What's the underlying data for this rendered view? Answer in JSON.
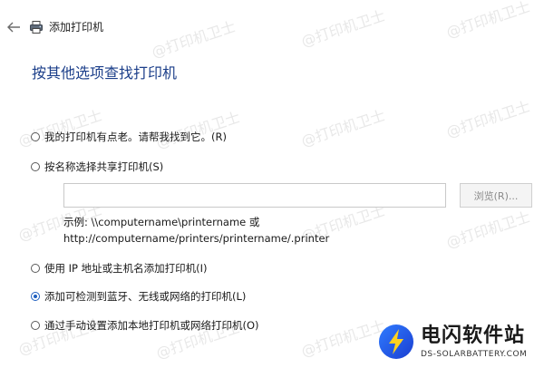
{
  "header": {
    "title": "添加打印机",
    "back_icon": "back-arrow-icon",
    "printer_icon": "printer-icon"
  },
  "heading": "按其他选项查找打印机",
  "options": [
    {
      "label": "我的打印机有点老。请帮我找到它。(R)",
      "checked": false
    },
    {
      "label": "按名称选择共享打印机(S)",
      "checked": false
    },
    {
      "label": "使用 IP 地址或主机名添加打印机(I)",
      "checked": false
    },
    {
      "label": "添加可检测到蓝牙、无线或网络的打印机(L)",
      "checked": true
    },
    {
      "label": "通过手动设置添加本地打印机或网络打印机(O)",
      "checked": false
    }
  ],
  "share_input": {
    "value": "",
    "placeholder": ""
  },
  "browse_label": "浏览(R)...",
  "example": {
    "line1": "示例: \\\\computername\\printername 或",
    "line2": "http://computername/printers/printername/.printer"
  },
  "watermark": "@打印机卫士",
  "logo": {
    "name": "电闪软件站",
    "sub": "DS-SOLARBATTERY.COM"
  },
  "colors": {
    "heading": "#1c3f8a",
    "radio_checked": "#1f5fbf"
  }
}
